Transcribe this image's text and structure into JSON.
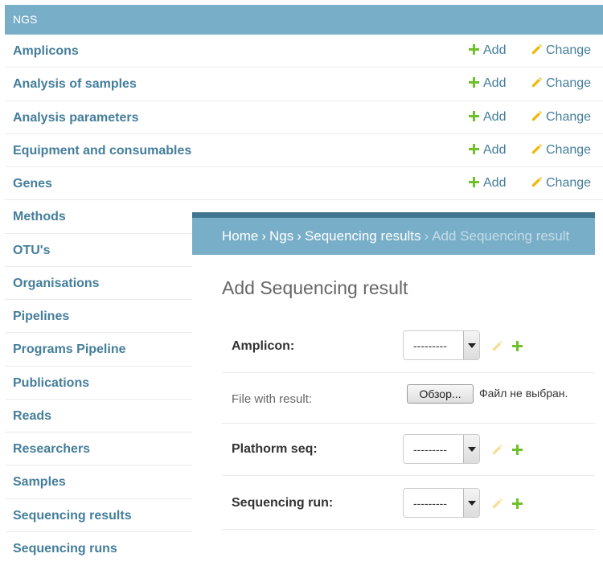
{
  "module": {
    "caption": "NGS",
    "add_label": "Add",
    "change_label": "Change",
    "models": [
      {
        "name": "Amplicons",
        "actions": true
      },
      {
        "name": "Analysis of samples",
        "actions": true
      },
      {
        "name": "Analysis parameters",
        "actions": true
      },
      {
        "name": "Equipment and consumables",
        "actions": true
      },
      {
        "name": "Genes",
        "actions": true
      },
      {
        "name": "Methods",
        "actions": false
      },
      {
        "name": "OTU's",
        "actions": false
      },
      {
        "name": "Organisations",
        "actions": false
      },
      {
        "name": "Pipelines",
        "actions": false
      },
      {
        "name": "Programs Pipeline",
        "actions": false
      },
      {
        "name": "Publications",
        "actions": false
      },
      {
        "name": "Reads",
        "actions": false
      },
      {
        "name": "Researchers",
        "actions": false
      },
      {
        "name": "Samples",
        "actions": false
      },
      {
        "name": "Sequencing results",
        "actions": false
      },
      {
        "name": "Sequencing runs",
        "actions": false
      }
    ]
  },
  "overlay": {
    "breadcrumbs": {
      "home": "Home",
      "app": "Ngs",
      "model": "Sequencing results",
      "current": "Add Sequencing result",
      "separator": "›"
    },
    "heading": "Add Sequencing result",
    "fields": {
      "amplicon": {
        "label": "Amplicon:",
        "value": "---------"
      },
      "file": {
        "label": "File with result:",
        "button": "Обзор...",
        "status": "Файл не выбран."
      },
      "plathorm": {
        "label": "Plathorm seq:",
        "value": "---------"
      },
      "run": {
        "label": "Sequencing run:",
        "value": "---------"
      }
    }
  },
  "colors": {
    "caption_bg": "#79aec8",
    "link": "#447e9b",
    "add_green": "#70bf2b",
    "change_yellow": "#efb80b",
    "header_dark": "#417690"
  },
  "icons": {
    "add": "plus-icon",
    "change": "pencil-icon",
    "select": "chevron-down-icon"
  }
}
